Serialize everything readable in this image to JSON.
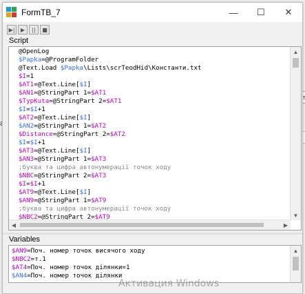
{
  "window": {
    "title": "FormTB_7",
    "controls": {
      "minimize": "—",
      "maximize": "☐",
      "close": "✕"
    }
  },
  "toolbar": {
    "buttons": [
      {
        "name": "run-to-end-button",
        "glyph": "▶|"
      },
      {
        "name": "run-button",
        "glyph": "▶"
      },
      {
        "name": "pause-button",
        "glyph": "||"
      },
      {
        "name": "stop-button",
        "glyph": "■"
      }
    ]
  },
  "script_section": {
    "label": "Script",
    "lines": [
      [
        [
          "cmd",
          "@OpenLog"
        ]
      ],
      [
        [
          "var-b",
          "$Papka"
        ],
        [
          "cmd",
          "=@ProgramFolder"
        ]
      ],
      [
        [
          "cmd",
          "@Text.Load "
        ],
        [
          "var-b",
          "$Papka"
        ],
        [
          "cmd",
          "\\Lists\\scrTeodHid\\Константи.txt"
        ]
      ],
      [
        [
          "var",
          "$I"
        ],
        [
          "cmd",
          "=1"
        ]
      ],
      [
        [
          "var",
          "$AT1"
        ],
        [
          "cmd",
          "=@Text.Line["
        ],
        [
          "var-b",
          "$I"
        ],
        [
          "cmd",
          "]"
        ]
      ],
      [
        [
          "var",
          "$AN1"
        ],
        [
          "cmd",
          "=@StringPart 1="
        ],
        [
          "var",
          "$AT1"
        ]
      ],
      [
        [
          "var",
          "$TypKuta"
        ],
        [
          "cmd",
          "=@StringPart 2="
        ],
        [
          "var",
          "$AT1"
        ]
      ],
      [
        [
          "var-b",
          "$I"
        ],
        [
          "cmd",
          "="
        ],
        [
          "var-b",
          "$I"
        ],
        [
          "cmd",
          "+1"
        ]
      ],
      [
        [
          "var",
          "$AT2"
        ],
        [
          "cmd",
          "=@Text.Line["
        ],
        [
          "var-b",
          "$I"
        ],
        [
          "cmd",
          "]"
        ]
      ],
      [
        [
          "var-b",
          "$AN2"
        ],
        [
          "cmd",
          "=@StringPart 1="
        ],
        [
          "var",
          "$AT2"
        ]
      ],
      [
        [
          "var",
          "$Distance"
        ],
        [
          "cmd",
          "=@StringPart 2="
        ],
        [
          "var",
          "$AT2"
        ]
      ],
      [
        [
          "var-b",
          "$I"
        ],
        [
          "cmd",
          "="
        ],
        [
          "var-b",
          "$I"
        ],
        [
          "cmd",
          "+1"
        ]
      ],
      [
        [
          "var",
          "$AT3"
        ],
        [
          "cmd",
          "=@Text.Line["
        ],
        [
          "var-b",
          "$I"
        ],
        [
          "cmd",
          "]"
        ]
      ],
      [
        [
          "var",
          "$AN3"
        ],
        [
          "cmd",
          "=@StringPart 1="
        ],
        [
          "var",
          "$AT3"
        ]
      ],
      [
        [
          "cmt",
          ";буква та цифра автонумерації точок ходу"
        ]
      ],
      [
        [
          "var",
          "$NBC"
        ],
        [
          "cmd",
          "=@StringPart 2="
        ],
        [
          "var",
          "$AT3"
        ]
      ],
      [
        [
          "var",
          "$I"
        ],
        [
          "cmd",
          "="
        ],
        [
          "var",
          "$I"
        ],
        [
          "cmd",
          "+1"
        ]
      ],
      [
        [
          "var",
          "$AT9"
        ],
        [
          "cmd",
          "=@Text.Line["
        ],
        [
          "var-b",
          "$I"
        ],
        [
          "cmd",
          "]"
        ]
      ],
      [
        [
          "var",
          "$AN9"
        ],
        [
          "cmd",
          "=@StringPart 1="
        ],
        [
          "var",
          "$AT9"
        ]
      ],
      [
        [
          "cmt",
          ";буква та цифра автонумерації точок ходу"
        ]
      ],
      [
        [
          "var",
          "$NBC2"
        ],
        [
          "cmd",
          "=@StringPart 2="
        ],
        [
          "var",
          "$AT9"
        ]
      ]
    ]
  },
  "variables_section": {
    "label": "Variables",
    "lines": [
      [
        [
          "var",
          "$AN9"
        ],
        [
          "cmd",
          "=Поч. номер точок висячого ходу"
        ]
      ],
      [
        [
          "var",
          "$NBC2"
        ],
        [
          "cmd",
          "=т.1"
        ]
      ],
      [
        [
          "var",
          "$AT4"
        ],
        [
          "cmd",
          "=Поч. номер точок ділянки=1"
        ]
      ],
      [
        [
          "var-b",
          "$AN4"
        ],
        [
          "cmd",
          "=Поч. номер точок ділянки"
        ]
      ]
    ]
  },
  "watermark": "Активация Windows",
  "background_fragments": {
    "left_letter": "a",
    "right_text": "от"
  },
  "colors": {
    "variable": "#c000c0",
    "variable_alt": "#3a6cff",
    "comment": "#8a8a8a"
  }
}
